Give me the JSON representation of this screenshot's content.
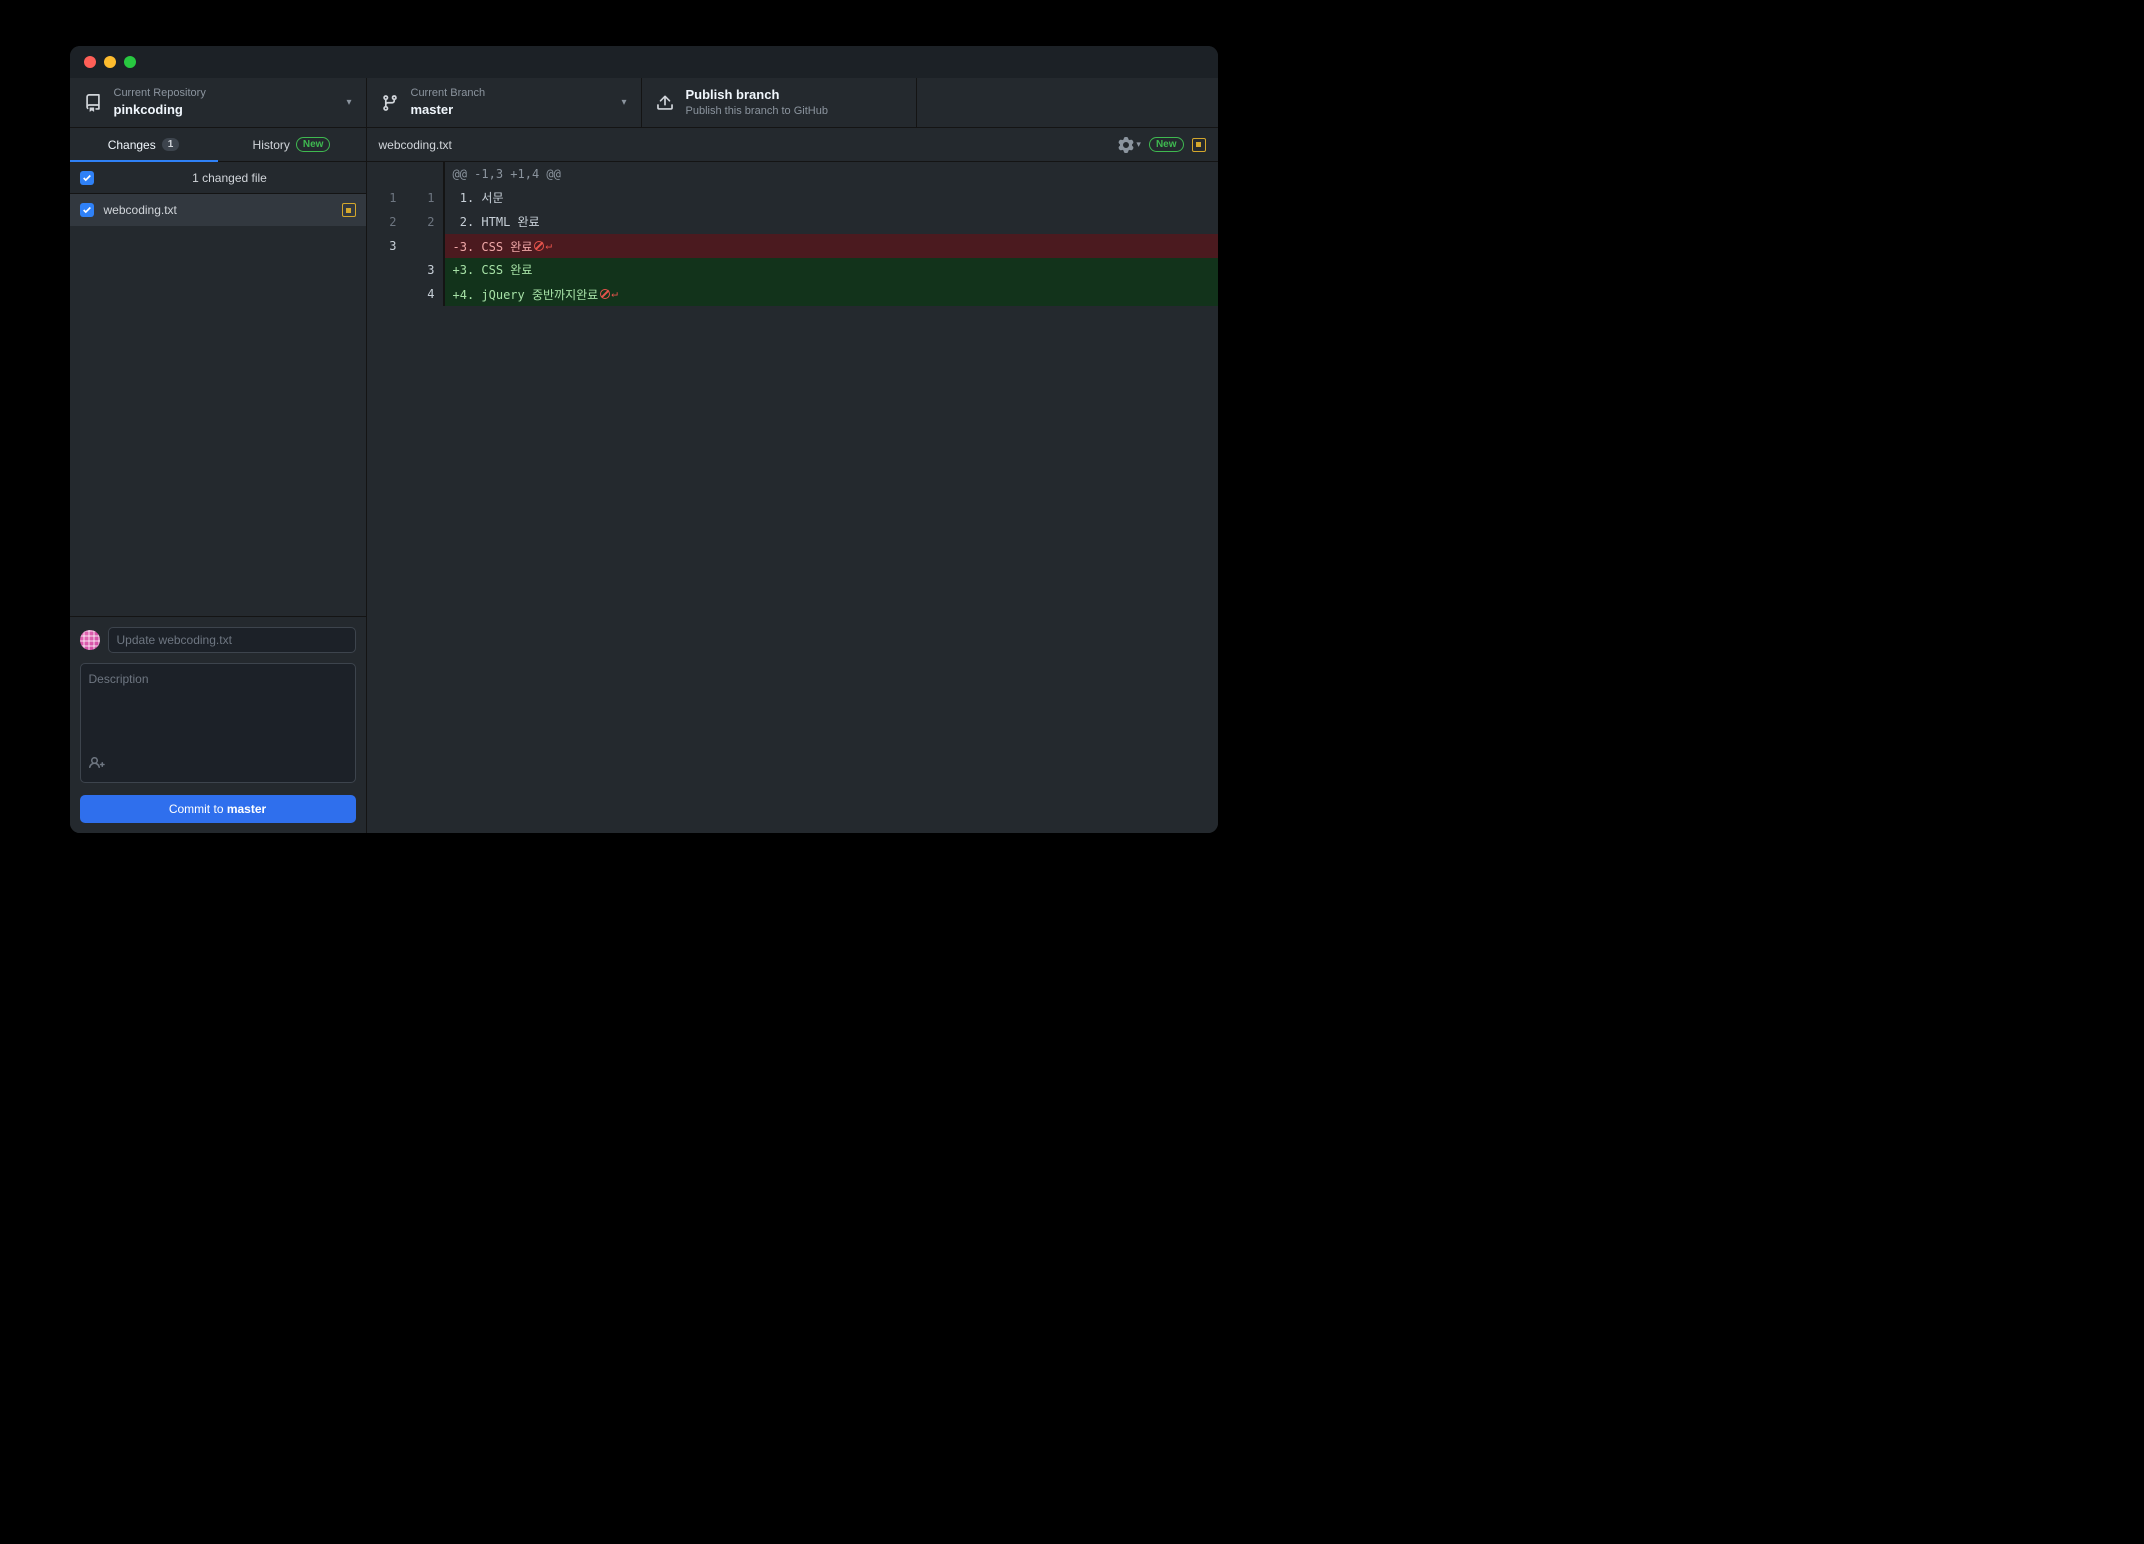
{
  "toolbar": {
    "repo_label": "Current Repository",
    "repo_name": "pinkcoding",
    "branch_label": "Current Branch",
    "branch_name": "master",
    "publish_title": "Publish branch",
    "publish_subtitle": "Publish this branch to GitHub"
  },
  "tabs": {
    "changes_label": "Changes",
    "changes_count": "1",
    "history_label": "History",
    "history_badge": "New"
  },
  "changes": {
    "header": "1 changed file",
    "file": "webcoding.txt"
  },
  "commit": {
    "summary_placeholder": "Update webcoding.txt",
    "description_placeholder": "Description",
    "button_prefix": "Commit to ",
    "button_branch": "master"
  },
  "diff": {
    "filename": "webcoding.txt",
    "header_badge": "New",
    "hunk": "@@ -1,3 +1,4 @@",
    "lines": [
      {
        "old": "1",
        "new": "1",
        "type": "ctx",
        "text": " 1. 서문"
      },
      {
        "old": "2",
        "new": "2",
        "type": "ctx",
        "text": " 2. HTML 완료"
      },
      {
        "old": "3",
        "new": "",
        "type": "del",
        "text": "-3. CSS 완료",
        "marker": true
      },
      {
        "old": "",
        "new": "3",
        "type": "add",
        "text": "+3. CSS 완료"
      },
      {
        "old": "",
        "new": "4",
        "type": "add",
        "text": "+4. jQuery 중반까지완료",
        "marker": true
      }
    ]
  }
}
